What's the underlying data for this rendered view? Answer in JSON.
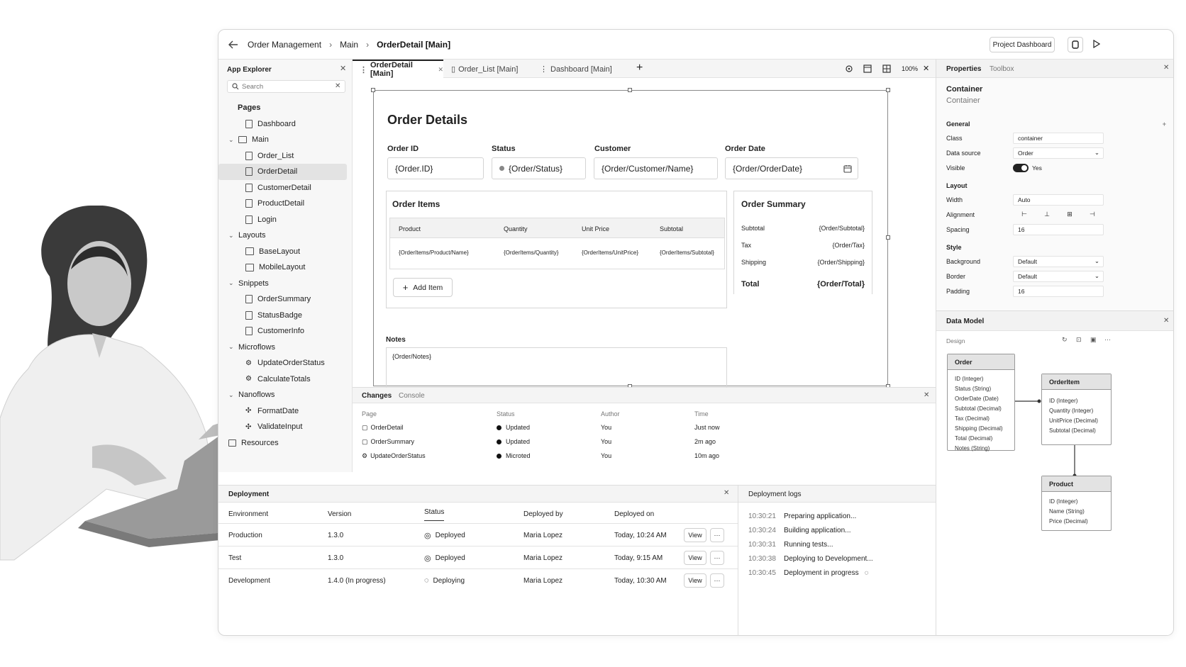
{
  "breadcrumb": {
    "items": [
      "Order Management",
      "Main",
      "OrderDetail [Main]"
    ]
  },
  "header": {
    "project_dashboard": "Project Dashboard"
  },
  "explorer": {
    "title": "App Explorer",
    "search_placeholder": "Search",
    "sections": [
      {
        "label": "Pages",
        "items": [
          "Dashboard"
        ]
      },
      {
        "label": "Main",
        "items": [
          "Order_List",
          "OrderDetail",
          "CustomerDetail",
          "ProductDetail",
          "Login"
        ]
      },
      {
        "label": "Layouts",
        "items": [
          "BaseLayout",
          "MobileLayout"
        ]
      },
      {
        "label": "Snippets",
        "items": [
          "OrderSummary",
          "StatusBadge",
          "CustomerInfo"
        ]
      },
      {
        "label": "Microflows",
        "items": [
          "UpdateOrderStatus",
          "CalculateTotals"
        ]
      },
      {
        "label": "Nanoflows",
        "items": [
          "FormatDate",
          "ValidateInput"
        ]
      }
    ],
    "resources": "Resources"
  },
  "tabs": [
    {
      "label": "OrderDetail [Main]"
    },
    {
      "label": "Order_List [Main]"
    },
    {
      "label": "Dashboard [Main]"
    }
  ],
  "canvas": {
    "zoom": "100%"
  },
  "form": {
    "title": "Order Details",
    "fields": [
      {
        "label": "Order ID",
        "value": "{Order.ID}"
      },
      {
        "label": "Status",
        "value": "{Order/Status}"
      },
      {
        "label": "Customer",
        "value": "{Order/Customer/Name}"
      },
      {
        "label": "Order Date",
        "value": "{Order/OrderDate}"
      }
    ],
    "items_title": "Order Items",
    "items_headers": [
      "Product",
      "Quantity",
      "Unit Price",
      "Subtotal"
    ],
    "items_row": [
      "{OrderItems/Product/Name}",
      "{OrderItems/Quantity}",
      "{OrderItems/UnitPrice}",
      "{OrderItems/Subtotal}"
    ],
    "add_item": "Add Item",
    "summary_title": "Order Summary",
    "summary": [
      {
        "label": "Subtotal",
        "value": "{Order/Subtotal}"
      },
      {
        "label": "Tax",
        "value": "{Order/Tax}"
      },
      {
        "label": "Shipping",
        "value": "{Order/Shipping}"
      }
    ],
    "total_label": "Total",
    "total_value": "{Order/Total}",
    "notes_label": "Notes",
    "notes_value": "{Order/Notes}"
  },
  "changes": {
    "tabs": [
      "Changes",
      "Console"
    ],
    "headers": [
      "Page",
      "Status",
      "Author",
      "Time"
    ],
    "rows": [
      {
        "page": "OrderDetail",
        "status": "Updated",
        "author": "You",
        "time": "Just now"
      },
      {
        "page": "OrderSummary",
        "status": "Updated",
        "author": "You",
        "time": "2m ago"
      },
      {
        "page": "UpdateOrderStatus",
        "status": "Microted",
        "author": "You",
        "time": "10m ago"
      }
    ]
  },
  "deployment": {
    "title": "Deployment",
    "headers": [
      "Environment",
      "Version",
      "Status",
      "Deployed by",
      "Deployed on"
    ],
    "rows": [
      {
        "env": "Production",
        "version": "1.3.0",
        "status": "Deployed",
        "by": "Maria Lopez",
        "on": "Today, 10:24 AM",
        "view": "View"
      },
      {
        "env": "Test",
        "version": "1.3.0",
        "status": "Deployed",
        "by": "Maria Lopez",
        "on": "Today, 9:15 AM",
        "view": "View"
      },
      {
        "env": "Development",
        "version": "1.4.0 (In progress)",
        "status": "Deploying",
        "by": "Maria Lopez",
        "on": "Today, 10:30 AM",
        "view": "View"
      }
    ]
  },
  "logs": {
    "title": "Deployment logs",
    "entries": [
      {
        "time": "10:30:21",
        "text": "Preparing application..."
      },
      {
        "time": "10:30:24",
        "text": "Building application..."
      },
      {
        "time": "10:30:31",
        "text": "Running tests..."
      },
      {
        "time": "10:30:38",
        "text": "Deploying to Development..."
      },
      {
        "time": "10:30:45",
        "text": "Deployment in progress"
      }
    ]
  },
  "properties": {
    "tabs": [
      "Properties",
      "Toolbox"
    ],
    "element_name": "Container",
    "element_type": "Container",
    "groups": {
      "general": "General",
      "layout": "Layout",
      "style": "Style"
    },
    "class_label": "Class",
    "class_value": "container",
    "datasource_label": "Data source",
    "datasource_value": "Order",
    "visible_label": "Visible",
    "visible_value": "Yes",
    "width_label": "Width",
    "width_value": "Auto",
    "alignment_label": "Alignment",
    "spacing_label": "Spacing",
    "spacing_value": "16",
    "background_label": "Background",
    "background_value": "Default",
    "border_label": "Border",
    "border_value": "Default",
    "padding_label": "Padding",
    "padding_value": "16"
  },
  "datamodel": {
    "title": "Data Model",
    "sub": "Design",
    "entities": [
      {
        "name": "Order",
        "attrs": [
          "ID (Integer)",
          "Status (String)",
          "OrderDate (Date)",
          "Subtotal (Decimal)",
          "Tax (Decimal)",
          "Shipping (Decimal)",
          "Total (Decimal)",
          "Notes (String)"
        ]
      },
      {
        "name": "OrderItem",
        "attrs": [
          "ID (Integer)",
          "Quantity (Integer)",
          "UnitPrice (Decimal)",
          "Subtotal (Decimal)"
        ]
      },
      {
        "name": "Product",
        "attrs": [
          "ID (Integer)",
          "Name (String)",
          "Price (Decimal)"
        ]
      }
    ]
  }
}
